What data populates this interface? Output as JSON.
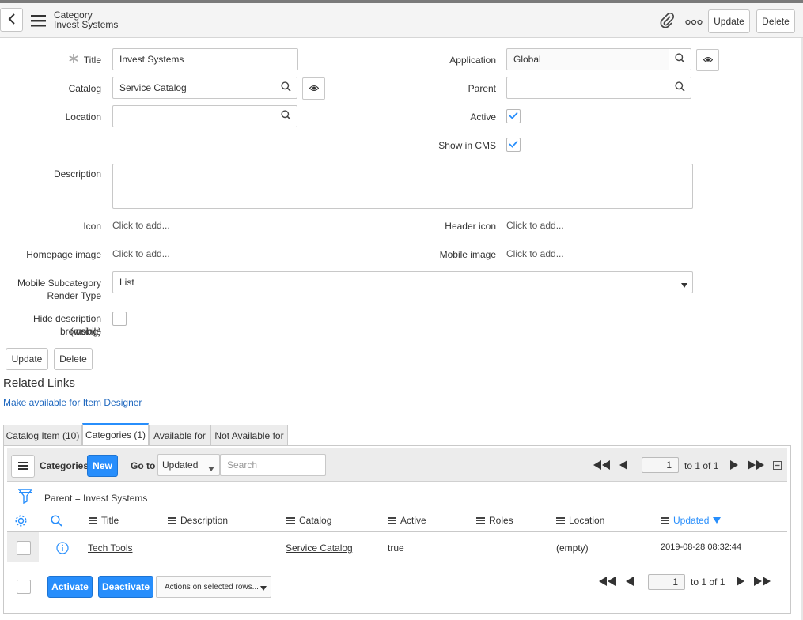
{
  "header": {
    "type_label": "Category",
    "record_name": "Invest Systems",
    "update_label": "Update",
    "delete_label": "Delete"
  },
  "form": {
    "title_label": "Title",
    "title_value": "Invest Systems",
    "catalog_label": "Catalog",
    "catalog_value": "Service Catalog",
    "location_label": "Location",
    "location_value": "",
    "application_label": "Application",
    "application_value": "Global",
    "parent_label": "Parent",
    "parent_value": "",
    "active_label": "Active",
    "active_checked": true,
    "show_cms_label": "Show in CMS",
    "show_cms_checked": true,
    "description_label": "Description",
    "description_value": "",
    "icon_label": "Icon",
    "icon_value": "Click to add...",
    "header_icon_label": "Header icon",
    "header_icon_value": "Click to add...",
    "homepage_image_label": "Homepage image",
    "homepage_image_value": "Click to add...",
    "mobile_image_label": "Mobile image",
    "mobile_image_value": "Click to add...",
    "mobile_render_label_1": "Mobile Subcategory",
    "mobile_render_label_2": "Render Type",
    "mobile_render_value": "List",
    "hide_desc_label_1": "Hide description (mobile",
    "hide_desc_label_2": "browsing)",
    "hide_desc_checked": false,
    "update_label": "Update",
    "delete_label": "Delete"
  },
  "related_links": {
    "heading": "Related Links",
    "item_designer_link": "Make available for Item Designer"
  },
  "tabs": [
    {
      "label": "Catalog Item (10)"
    },
    {
      "label": "Categories (1)"
    },
    {
      "label": "Available for"
    },
    {
      "label": "Not Available for"
    }
  ],
  "list": {
    "title": "Categories",
    "new_label": "New",
    "goto_label": "Go to",
    "goto_field": "Updated",
    "search_placeholder": "Search",
    "page_value": "1",
    "page_of": "to 1 of 1",
    "breadcrumb": "Parent = Invest Systems",
    "columns": [
      "Title",
      "Description",
      "Catalog",
      "Active",
      "Roles",
      "Location",
      "Updated"
    ],
    "sort_column": "Updated",
    "rows": [
      {
        "title": "Tech Tools",
        "description": "",
        "catalog": "Service Catalog",
        "active": "true",
        "roles": "",
        "location": "(empty)",
        "updated": "2019-08-28 08:32:44"
      }
    ],
    "activate_label": "Activate",
    "deactivate_label": "Deactivate",
    "actions_label": "Actions on selected rows..."
  },
  "colors": {
    "accent": "#278efc",
    "link": "#1f68bf",
    "header_bg": "#f4f4f4"
  }
}
